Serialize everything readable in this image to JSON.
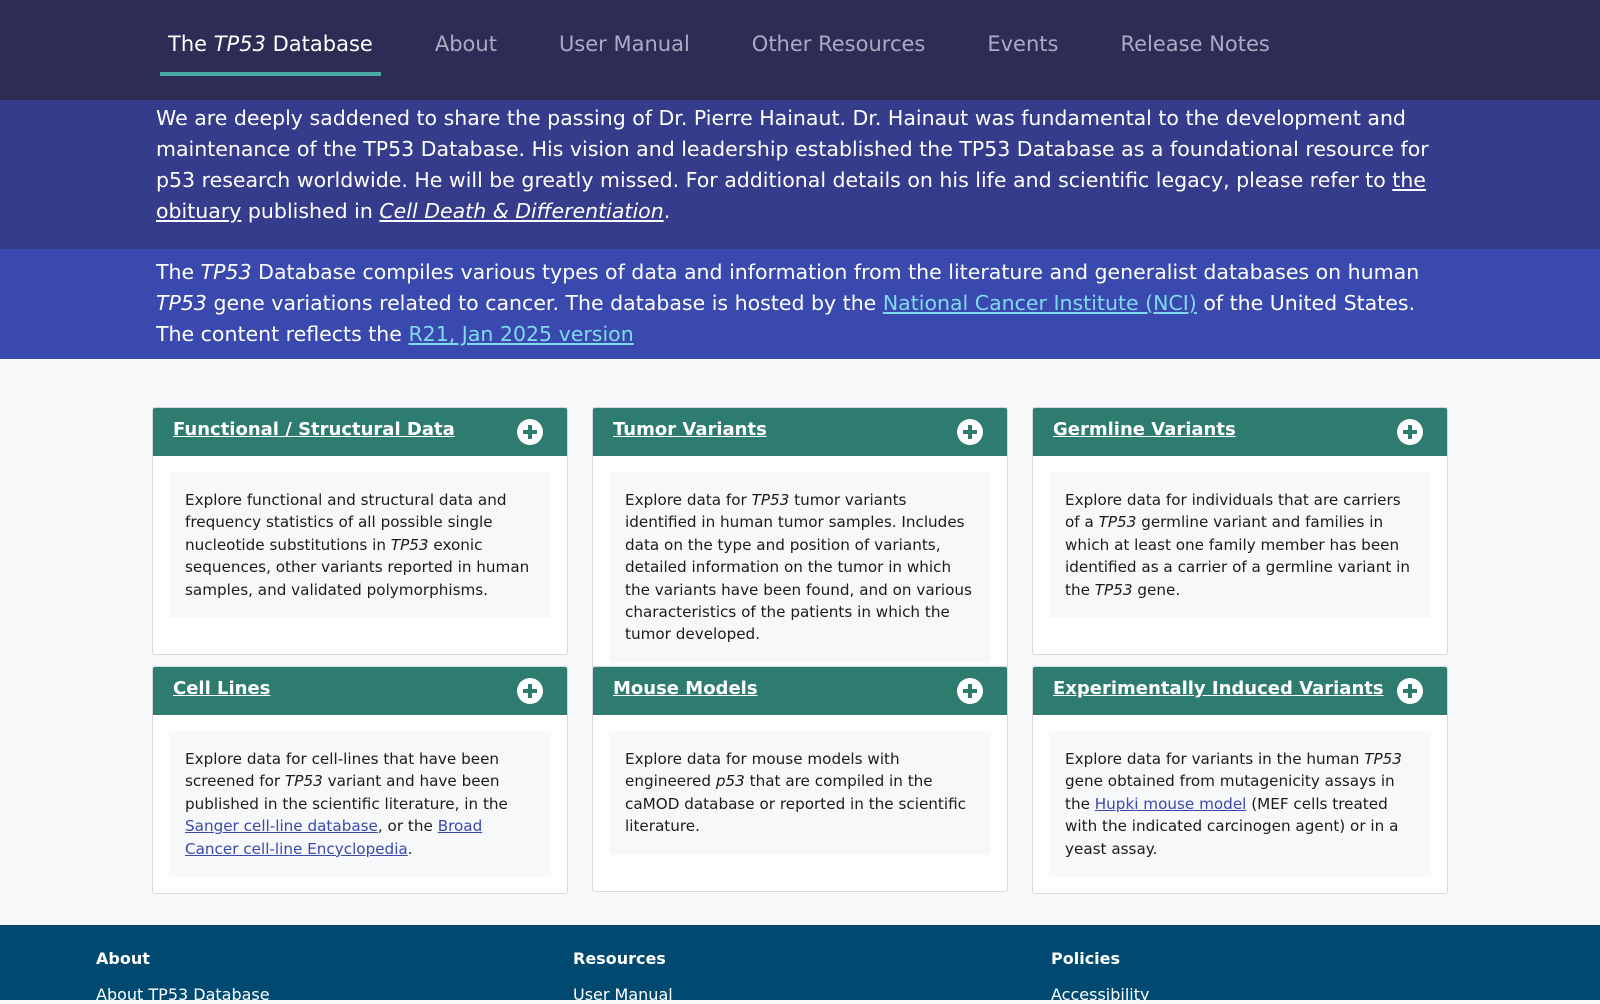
{
  "nav": {
    "home_pre": "The ",
    "home_italic": "TP53",
    "home_post": " Database",
    "about": "About",
    "user_manual": "User Manual",
    "other_resources": "Other Resources",
    "events": "Events",
    "release_notes": "Release Notes"
  },
  "memorial": {
    "text1": "We are deeply saddened to share the passing of Dr. Pierre Hainaut. Dr. Hainaut was fundamental to the development and maintenance of the TP53 Database. His vision and leadership established the TP53 Database as a foundational resource for p53 research worldwide. He will be greatly missed. For additional details on his life and scientific legacy, please refer to ",
    "link_obituary": "the obituary",
    "text2": " published in ",
    "journal": "Cell Death & Differentiation",
    "text3": "."
  },
  "intro": {
    "t1": "The ",
    "i1": "TP53",
    "t2": " Database compiles various types of data and information from the literature and generalist databases on human ",
    "i2": "TP53",
    "t3": " gene variations related to cancer. The database is hosted by the ",
    "link_nci": "National Cancer Institute (NCI)",
    "t4": " of the United States. The content reflects the ",
    "link_version": "R21, Jan 2025 version"
  },
  "cards": {
    "functional": {
      "title": "Functional / Structural Data ",
      "t1": "Explore functional and structural data and frequency statistics of all possible single nucleotide substitutions in ",
      "i1": "TP53",
      "t2": " exonic sequences, other variants reported in human samples, and validated polymorphisms."
    },
    "tumor": {
      "title": "Tumor Variants ",
      "t1": "Explore data for ",
      "i1": "TP53",
      "t2": " tumor variants identified in human tumor samples. Includes data on the type and position of variants, detailed information on the tumor in which the variants have been found, and on various characteristics of the patients in which the tumor developed."
    },
    "germline": {
      "title": "Germline Variants ",
      "t1": "Explore data for individuals that are carriers of a ",
      "i1": "TP53",
      "t2": " germline variant and families in which at least one family member has been identified as a carrier of a germline variant in the ",
      "i2": "TP53",
      "t3": " gene."
    },
    "cell_lines": {
      "title": "Cell Lines ",
      "t1": "Explore data for cell-lines that have been screened for ",
      "i1": "TP53",
      "t2": " variant and have been published in the scientific literature, in the ",
      "link1": "Sanger cell-line database",
      "t3": ", or the ",
      "link2": "Broad Cancer cell-line Encyclopedia",
      "t4": "."
    },
    "mouse": {
      "title": "Mouse Models ",
      "t1": "Explore data for mouse models with engineered ",
      "i1": "p53",
      "t2": " that are compiled in the caMOD database or reported in the scientific literature."
    },
    "induced": {
      "title": "Experimentally Induced Variants ",
      "t1": "Explore data for variants in the human ",
      "i1": "TP53",
      "t2": " gene obtained from mutagenicity assays in the ",
      "link1": "Hupki mouse model",
      "t3": " (MEF cells treated with the indicated carcinogen agent) or in a yeast assay."
    }
  },
  "footer": {
    "about_head": "About",
    "about_link": "About TP53 Database",
    "resources_head": "Resources",
    "resources_link": "User Manual",
    "policies_head": "Policies",
    "policies_link": "Accessibility"
  },
  "colors": {
    "nav_bg": "#2e2c55",
    "memorial_bg": "#353c8c",
    "intro_bg": "#3a49ae",
    "card_header": "#2e7c6f",
    "footer_bg": "#004a72",
    "accent_underline": "#4aa8a3"
  },
  "icons": {
    "card_expand": "plus-circle-icon"
  }
}
